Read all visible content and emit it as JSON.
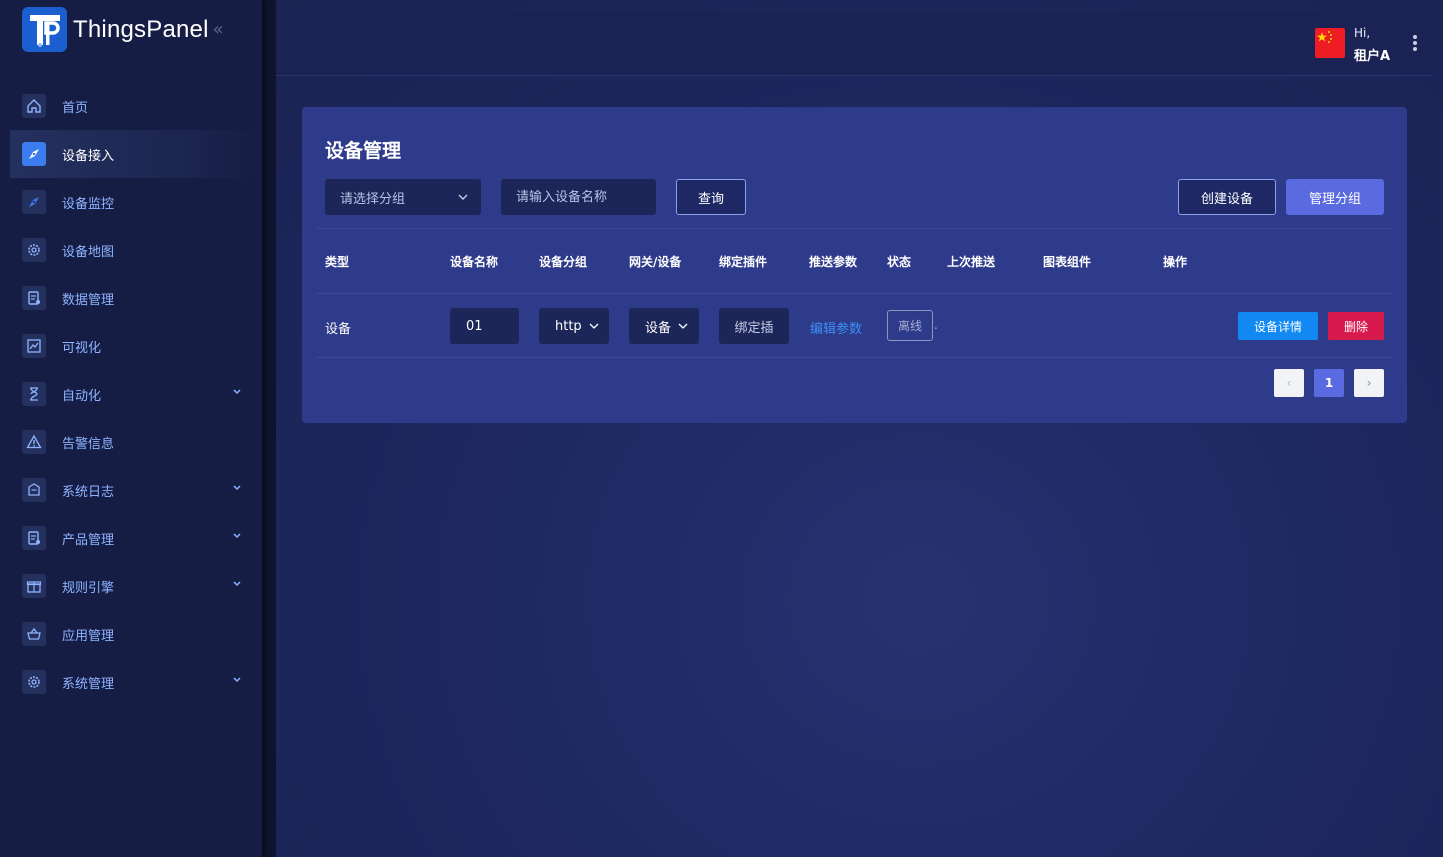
{
  "app": {
    "name": "ThingsPanel",
    "collapse_glyph": "«"
  },
  "sidebar": {
    "items": [
      {
        "label": "首页",
        "icon": "home-icon",
        "active": false,
        "expandable": false
      },
      {
        "label": "设备接入",
        "icon": "compass-icon",
        "active": true,
        "expandable": false
      },
      {
        "label": "设备监控",
        "icon": "compass-icon",
        "active": false,
        "expandable": false
      },
      {
        "label": "设备地图",
        "icon": "gear-icon",
        "active": false,
        "expandable": false
      },
      {
        "label": "数据管理",
        "icon": "clipboard-icon",
        "active": false,
        "expandable": false
      },
      {
        "label": "可视化",
        "icon": "chart-icon",
        "active": false,
        "expandable": false
      },
      {
        "label": "自动化",
        "icon": "hourglass-icon",
        "active": false,
        "expandable": true
      },
      {
        "label": "告警信息",
        "icon": "warning-icon",
        "active": false,
        "expandable": false
      },
      {
        "label": "系统日志",
        "icon": "log-icon",
        "active": false,
        "expandable": true
      },
      {
        "label": "产品管理",
        "icon": "clipboard-icon",
        "active": false,
        "expandable": true
      },
      {
        "label": "规则引擎",
        "icon": "gift-icon",
        "active": false,
        "expandable": true
      },
      {
        "label": "应用管理",
        "icon": "basket-icon",
        "active": false,
        "expandable": false
      },
      {
        "label": "系统管理",
        "icon": "gear-icon",
        "active": false,
        "expandable": true
      }
    ]
  },
  "header": {
    "greeting": "Hi,",
    "user": "租户A",
    "flag_icon": "china-flag-icon"
  },
  "page": {
    "title": "设备管理",
    "group_select": "请选择分组",
    "search_placeholder": "请输入设备名称",
    "query_label": "查询",
    "create_label": "创建设备",
    "manage_group_label": "管理分组"
  },
  "table": {
    "headers": [
      "类型",
      "设备名称",
      "设备分组",
      "网关/设备",
      "绑定插件",
      "推送参数",
      "状态",
      "上次推送",
      "图表组件",
      "操作"
    ],
    "rows": [
      {
        "type": "设备",
        "name": "01",
        "group": "http",
        "kind": "设备",
        "plugin": "绑定插",
        "push_params": "编辑参数",
        "status": "离线",
        "last_push": ".",
        "detail_label": "设备详情",
        "delete_label": "删除"
      }
    ]
  },
  "pagination": {
    "prev": "‹",
    "current": "1",
    "next": "›"
  },
  "colors": {
    "sidebar_bg": "#161d44",
    "card_bg": "#2e3a8a",
    "accent": "#5a6ae0",
    "primary_blue": "#1289f2",
    "danger": "#d8194d",
    "link": "#3d8ff5"
  }
}
